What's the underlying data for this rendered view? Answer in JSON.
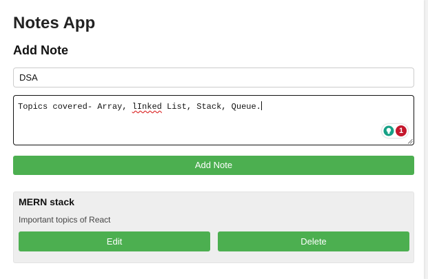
{
  "app": {
    "title": "Notes App"
  },
  "form": {
    "heading": "Add Note",
    "title_value": "DSA",
    "content_before_typo": "Topics covered- Array, ",
    "content_typo": "lInked",
    "content_after_typo": " List, Stack, Queue.",
    "assistant_badge_count": "1",
    "add_button_label": "Add Note"
  },
  "notes": [
    {
      "title": "MERN stack",
      "content": "Important topics of React",
      "edit_label": "Edit",
      "delete_label": "Delete"
    }
  ],
  "icons": {
    "assistant": "bulb-icon",
    "resize": "resize-grip-icon"
  },
  "colors": {
    "accent": "#4caf50",
    "card_background": "#eeeeee",
    "badge": "#c4172c",
    "assistant_bulb": "#16a085"
  }
}
